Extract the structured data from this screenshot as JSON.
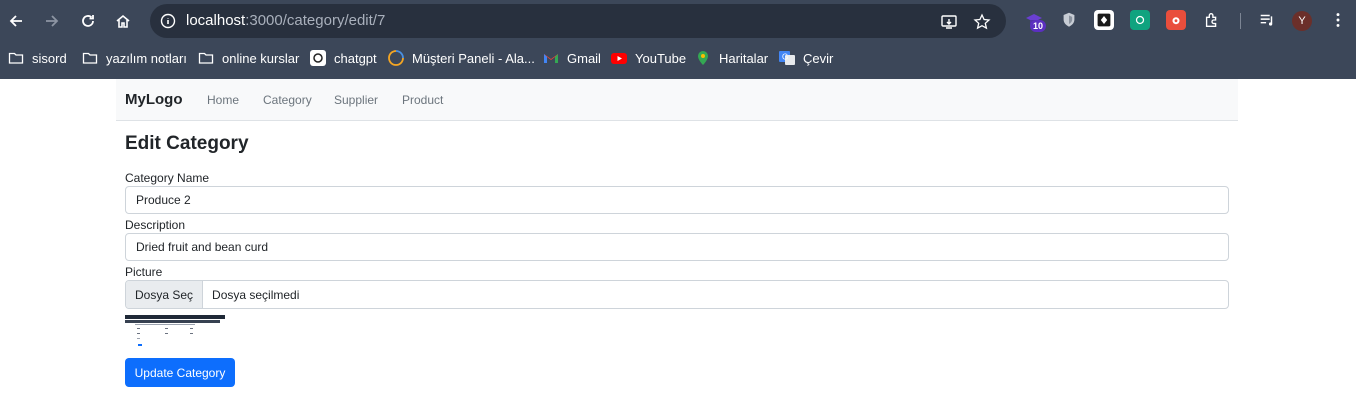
{
  "browser": {
    "url_host": "localhost",
    "url_rest": ":3000/category/edit/7",
    "extension_badge": "10",
    "profile_initial": "Y"
  },
  "bookmarks": [
    {
      "label": "sisord",
      "icon": "folder-icon"
    },
    {
      "label": "yazılım notları",
      "icon": "folder-icon"
    },
    {
      "label": "online kurslar",
      "icon": "folder-icon"
    },
    {
      "label": "chatgpt",
      "icon": "chatgpt-icon"
    },
    {
      "label": "Müşteri Paneli - Ala...",
      "icon": "customer-panel-icon"
    },
    {
      "label": "Gmail",
      "icon": "gmail-icon"
    },
    {
      "label": "YouTube",
      "icon": "youtube-icon"
    },
    {
      "label": "Haritalar",
      "icon": "maps-icon"
    },
    {
      "label": "Çevir",
      "icon": "translate-icon"
    }
  ],
  "navbar": {
    "brand": "MyLogo",
    "links": [
      "Home",
      "Category",
      "Supplier",
      "Product"
    ]
  },
  "form": {
    "title": "Edit Category",
    "category_name_label": "Category Name",
    "category_name_value": "Produce 2",
    "description_label": "Description",
    "description_value": "Dried fruit and bean curd",
    "picture_label": "Picture",
    "file_button": "Dosya Seç",
    "file_status": "Dosya seçilmedi",
    "submit": "Update Category"
  },
  "colors": {
    "chrome_bg": "#3c4759",
    "primary": "#0d6efd"
  }
}
